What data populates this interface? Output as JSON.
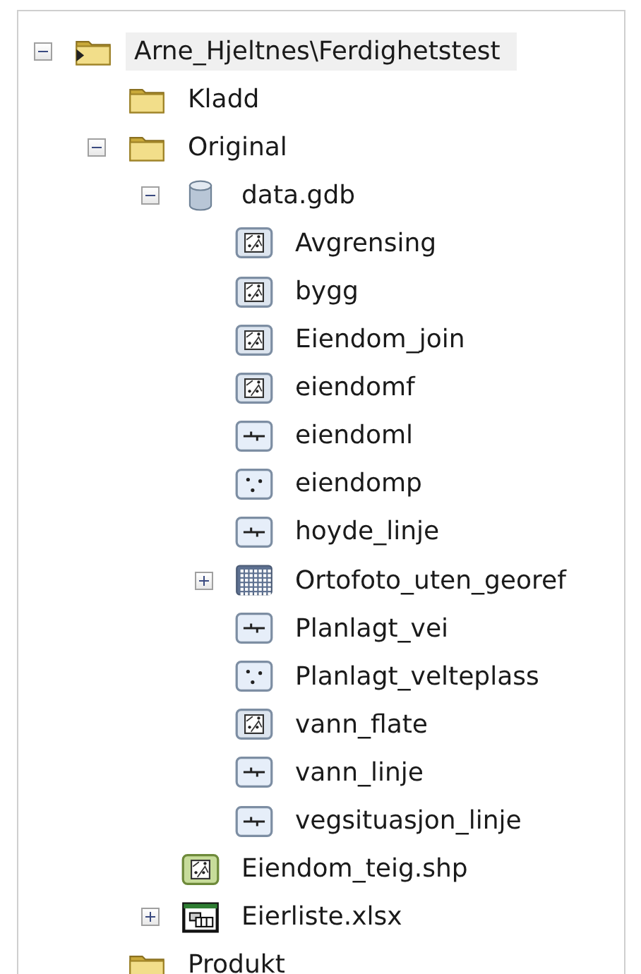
{
  "tree": [
    {
      "label": "Arne_Hjeltnes\\Ferdighetstest",
      "kind": "folder-connection",
      "expanded": true,
      "selected": true,
      "children": [
        {
          "label": "Kladd",
          "kind": "folder",
          "selected": false
        },
        {
          "label": "Original",
          "kind": "folder",
          "expanded": true,
          "selected": false,
          "children": [
            {
              "label": "data.gdb",
              "kind": "geodatabase",
              "expanded": true,
              "selected": false,
              "children": [
                {
                  "label": "Avgrensing",
                  "kind": "polygon",
                  "selected": false
                },
                {
                  "label": "bygg",
                  "kind": "polygon",
                  "selected": false
                },
                {
                  "label": "Eiendom_join",
                  "kind": "polygon",
                  "selected": false
                },
                {
                  "label": "eiendomf",
                  "kind": "polygon",
                  "selected": false
                },
                {
                  "label": "eiendoml",
                  "kind": "line",
                  "selected": false
                },
                {
                  "label": "eiendomp",
                  "kind": "point",
                  "selected": false
                },
                {
                  "label": "hoyde_linje",
                  "kind": "line",
                  "selected": false
                },
                {
                  "label": "Ortofoto_uten_georef",
                  "kind": "raster",
                  "expanded": false,
                  "selected": false
                },
                {
                  "label": "Planlagt_vei",
                  "kind": "line",
                  "selected": false
                },
                {
                  "label": "Planlagt_velteplass",
                  "kind": "point",
                  "selected": false
                },
                {
                  "label": "vann_flate",
                  "kind": "polygon",
                  "selected": false
                },
                {
                  "label": "vann_linje",
                  "kind": "line",
                  "selected": false
                },
                {
                  "label": "vegsituasjon_linje",
                  "kind": "line",
                  "selected": false
                }
              ]
            },
            {
              "label": "Eiendom_teig.shp",
              "kind": "shapefile",
              "selected": false
            },
            {
              "label": "Eierliste.xlsx",
              "kind": "table",
              "expanded": false,
              "selected": false
            }
          ]
        },
        {
          "label": "Produkt",
          "kind": "folder",
          "selected": false
        }
      ]
    }
  ]
}
